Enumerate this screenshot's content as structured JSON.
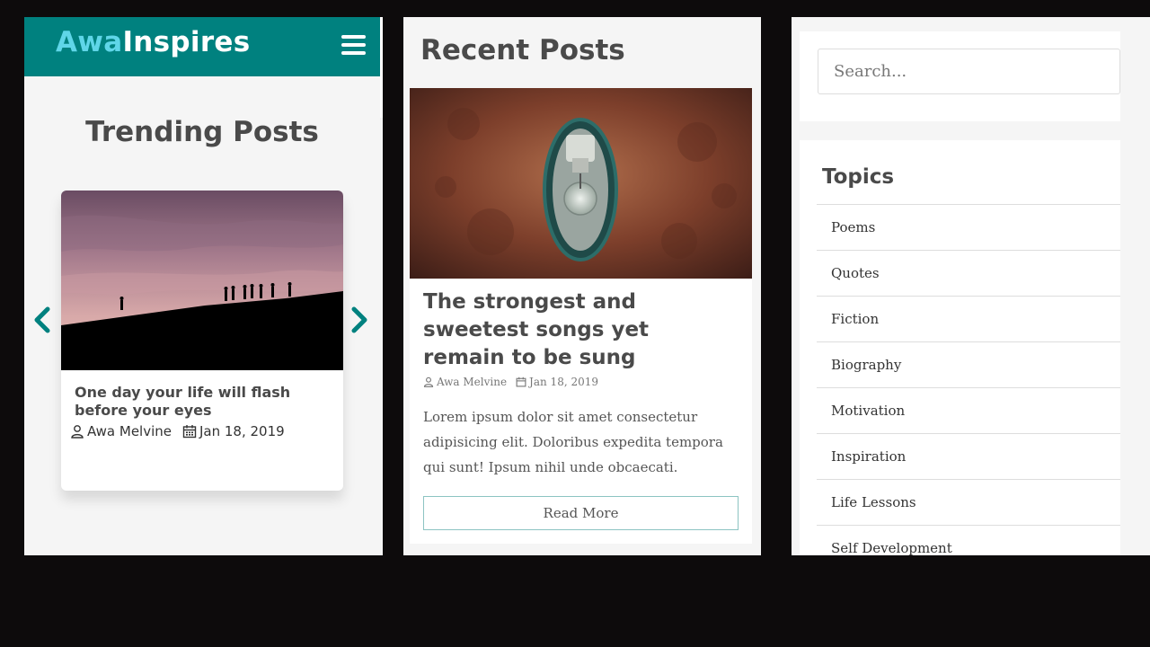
{
  "brand": {
    "part1": "Awa",
    "part2": "Inspires",
    "accent_color": "#00817f",
    "light_accent": "#5fd6e8"
  },
  "trending": {
    "title": "Trending Posts",
    "card": {
      "title": "One day your life will flash before your eyes",
      "author": "Awa Melvine",
      "date": "Jan 18, 2019"
    },
    "prev_icon": "chevron-left-icon",
    "next_icon": "chevron-right-icon"
  },
  "recent": {
    "title": "Recent Posts",
    "post": {
      "title": "The strongest and sweetest songs yet remain to be sung",
      "author": "Awa Melvine",
      "date": "Jan 18, 2019",
      "excerpt": "Lorem ipsum dolor sit amet consectetur adipisicing elit. Doloribus expedita tempora qui sunt! Ipsum nihil unde obcaecati.",
      "read_more": "Read More"
    }
  },
  "sidebar": {
    "search": {
      "placeholder": "Search..."
    },
    "topics": {
      "title": "Topics",
      "items": [
        "Poems",
        "Quotes",
        "Fiction",
        "Biography",
        "Motivation",
        "Inspiration",
        "Life Lessons",
        "Self Development"
      ]
    }
  }
}
